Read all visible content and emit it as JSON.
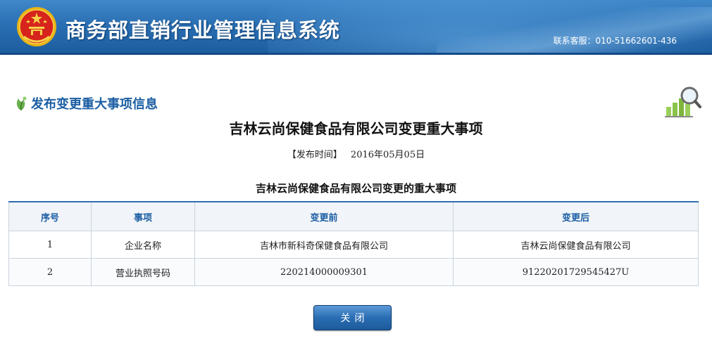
{
  "header": {
    "system_title": "商务部直销行业管理信息系统",
    "hotline": "联系客服：010-51662601-436"
  },
  "section": {
    "title": "发布变更重大事项信息"
  },
  "notice": {
    "title": "吉林云尚保健食品有限公司变更重大事项",
    "publish_label": "【发布时间】",
    "publish_date": "2016年05月05日",
    "table_title": "吉林云尚保健食品有限公司变更的重大事项"
  },
  "table": {
    "headers": [
      "序号",
      "事项",
      "变更前",
      "变更后"
    ],
    "rows": [
      [
        "1",
        "企业名称",
        "吉林市新科奇保健食品有限公司",
        "吉林云尚保健食品有限公司"
      ],
      [
        "2",
        "营业执照号码",
        "220214000009301",
        "91220201729545427U"
      ]
    ]
  },
  "buttons": {
    "close_label": "关闭"
  },
  "colors": {
    "banner": "#2a6fb3",
    "heading_blue": "#1b5ea3",
    "emblem_red": "#d6241c",
    "emblem_gold": "#f2c21a"
  },
  "icons": [
    "national-emblem-icon",
    "leaf-icon",
    "chart-magnifier-icon"
  ]
}
